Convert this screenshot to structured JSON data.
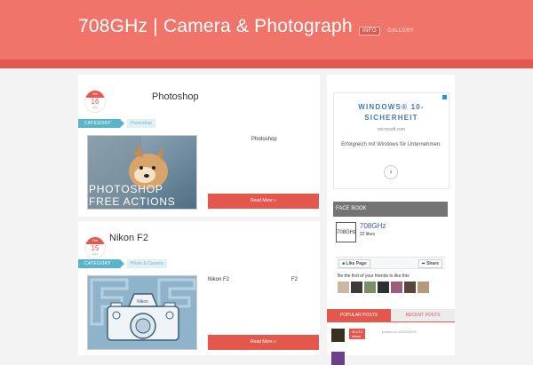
{
  "header": {
    "site_title": "708GHz | Camera & Photograph",
    "nav": [
      {
        "label": "INFO",
        "active": true
      },
      {
        "label": "GALLERY",
        "active": false
      }
    ],
    "colors": {
      "header_bg": "#f0746a",
      "header_band": "#e4574c"
    }
  },
  "posts": [
    {
      "date": {
        "month": "Oct",
        "day": "16",
        "year": "2016"
      },
      "title": "Photoshop",
      "category_label": "CATEGORY",
      "category": "Photoshop",
      "thumbnail_text": [
        "PHOTOSHOP",
        "FREE ACTIONS"
      ],
      "excerpt": "Photoshop",
      "read_more": "Read More »"
    },
    {
      "date": {
        "month": "Oct",
        "day": "15",
        "year": "2016"
      },
      "title": "Nikon F2",
      "category_label": "CATEGORY",
      "category": "Photo & Camera",
      "thumbnail_text": [],
      "excerpt_left": "Nikon F2",
      "excerpt_right": "F2",
      "read_more": "Read More »"
    }
  ],
  "sidebar": {
    "ad": {
      "title": "WINDOWS® 10-SICHERHEIT",
      "url": "microsoft.com",
      "description": "Erfolgreich mit Windows für Unternehmen.",
      "arrow_icon": "chevron-right-icon"
    },
    "facebook": {
      "header": "FACE BOOK",
      "logo_text": "708GHz",
      "page_name": "708GHz",
      "likes": "22 likes",
      "like_button": "Like Page",
      "share_button": "Share",
      "friends_text": "Be the first of your friends to like this"
    },
    "tabs": [
      {
        "label": "POPULAR POSTS",
        "active": true
      },
      {
        "label": "RECENT POSTS",
        "active": false
      }
    ],
    "popular_posts": [
      {
        "count": "40,213 views",
        "date": "posted on 2016/02/09"
      }
    ]
  }
}
